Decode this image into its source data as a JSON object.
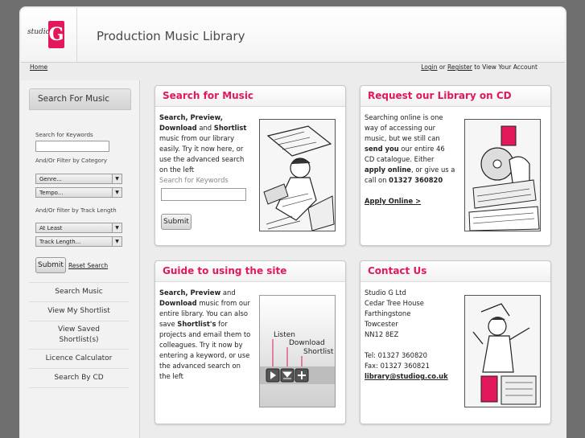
{
  "header": {
    "logo_script": "studio",
    "logo_letter": "G",
    "title": "Production Music Library"
  },
  "topnav": {
    "home": "Home",
    "login": "Login",
    "or": " or ",
    "register": "Register",
    "suffix": " to View Your Account"
  },
  "sidebar": {
    "tab": "Search For Music",
    "keywords_label": "Search for Keywords",
    "category_label": "And/Or Filter by Category",
    "genre_select": "Genre...",
    "tempo_select": "Tempo...",
    "length_label": "And/Or filter by Track Length",
    "atleast_select": "At Least",
    "tracklength_select": "Track Length...",
    "submit": "Submit",
    "reset": "Reset Search",
    "menu": [
      "Search Music",
      "View My Shortlist",
      "View Saved Shortlist(s)",
      "Licence Calculator",
      "Search By CD"
    ]
  },
  "panels": {
    "search": {
      "title": "Search for Music",
      "t1": "Search",
      "t2": ", ",
      "t3": "Preview",
      "t4": ", ",
      "t5": "Download",
      "t6": " and ",
      "t7": "Shortlist",
      "t8": " music from our library easily. Try it now here, or use the advanced search on the left",
      "keywords_label": "Search for Keywords",
      "submit": "Submit"
    },
    "request": {
      "title": "Request our Library on CD",
      "t1": "Searching online is one way of accessing our music, but we still can ",
      "t2": "send you",
      "t3": " our entire 46 CD catalogue. Either ",
      "t4": "apply online",
      "t5": ", or give us a call on ",
      "t6": "01327 360820",
      "link": "Apply Online >"
    },
    "guide": {
      "title": "Guide to using the site",
      "t1": "Search, Preview",
      "t2": " and ",
      "t3": "Download",
      "t4": " music from our entire library. You can also save ",
      "t5": "Shortlist's",
      "t6": " for projects and email them to colleagues. Try it now by entering a keyword, or use the advanced search on the left",
      "lbl_listen": "Listen",
      "lbl_download": "Download",
      "lbl_shortlist": "Shortlist"
    },
    "contact": {
      "title": "Contact Us",
      "lines": [
        "Studio G Ltd",
        "Cedar Tree House",
        "Farthingstone",
        "Towcester",
        "NN12 8EZ"
      ],
      "tel": "Tel: 01327 360820",
      "fax": "Fax: 01327 360821",
      "email": "library@studiog.co.uk"
    }
  },
  "colors": {
    "accent": "#e2185a",
    "background": "#6e6e6e"
  }
}
